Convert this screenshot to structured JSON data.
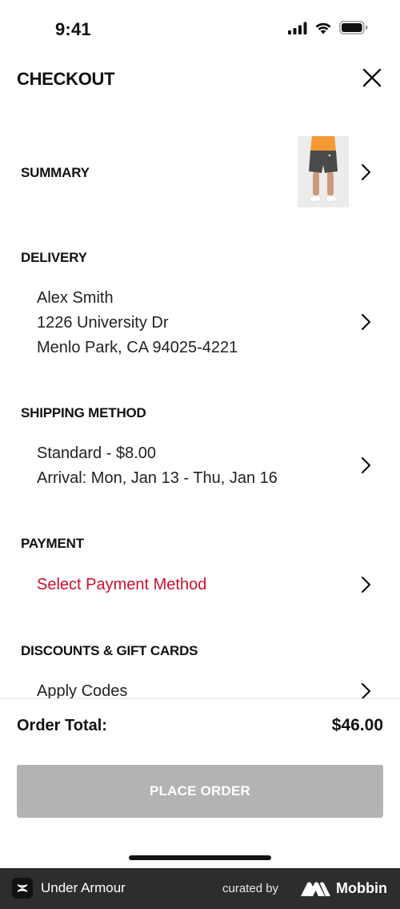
{
  "status_bar": {
    "time": "9:41"
  },
  "header": {
    "title": "CHECKOUT"
  },
  "summary": {
    "title": "SUMMARY",
    "thumbnail_icon": "shorts-product-image"
  },
  "delivery": {
    "title": "DELIVERY",
    "name": "Alex Smith",
    "street": "1226 University Dr",
    "city": "Menlo Park, CA 94025-4221"
  },
  "shipping": {
    "title": "SHIPPING METHOD",
    "method": "Standard - $8.00",
    "arrival": "Arrival: Mon, Jan 13 - Thu, Jan 16"
  },
  "payment": {
    "title": "PAYMENT",
    "action": "Select Payment Method",
    "action_color": "#c8102e"
  },
  "discounts": {
    "title": "DISCOUNTS & GIFT CARDS",
    "action": "Apply Codes"
  },
  "footer": {
    "total_label": "Order Total:",
    "total_value": "$46.00",
    "place_order_label": "PLACE ORDER",
    "place_order_color": "#b3b3b3"
  },
  "mobbin_bar": {
    "app_name": "Under Armour",
    "curated_by": "curated by",
    "brand": "Mobbin"
  }
}
